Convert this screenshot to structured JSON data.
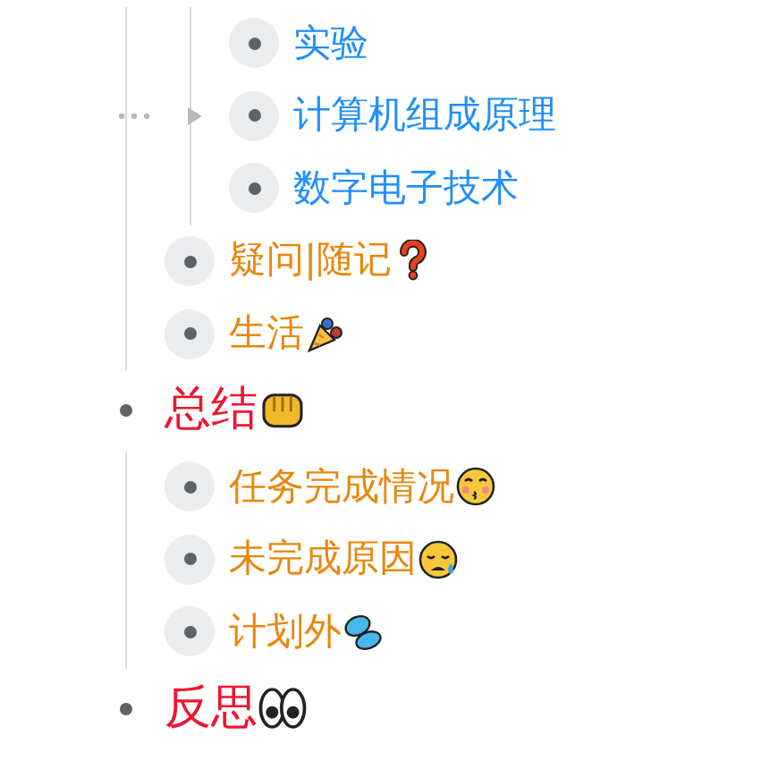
{
  "outline": [
    {
      "children": [
        {
          "children": [
            {
              "text": "实验",
              "collapsed": true,
              "hovered": false
            },
            {
              "text": "计算机组成原理",
              "collapsed": true,
              "hovered": true
            },
            {
              "text": "数字电子技术",
              "collapsed": true,
              "hovered": false
            }
          ]
        },
        {
          "text": "疑问|随记",
          "kind": "question",
          "collapsed": true,
          "hovered": false
        },
        {
          "text": "生活",
          "kind": "party",
          "collapsed": true,
          "hovered": false
        }
      ]
    },
    {
      "text": "总结",
      "kind": "fist",
      "collapsed": false,
      "hovered": false,
      "children": [
        {
          "text": "任务完成情况",
          "kind": "kiss",
          "collapsed": true,
          "hovered": false
        },
        {
          "text": "未完成原因",
          "kind": "sad",
          "collapsed": true,
          "hovered": false
        },
        {
          "text": "计划外",
          "kind": "drops",
          "collapsed": true,
          "hovered": false
        }
      ]
    },
    {
      "text": "反思",
      "kind": "eyes",
      "collapsed": false,
      "hovered": false
    }
  ]
}
